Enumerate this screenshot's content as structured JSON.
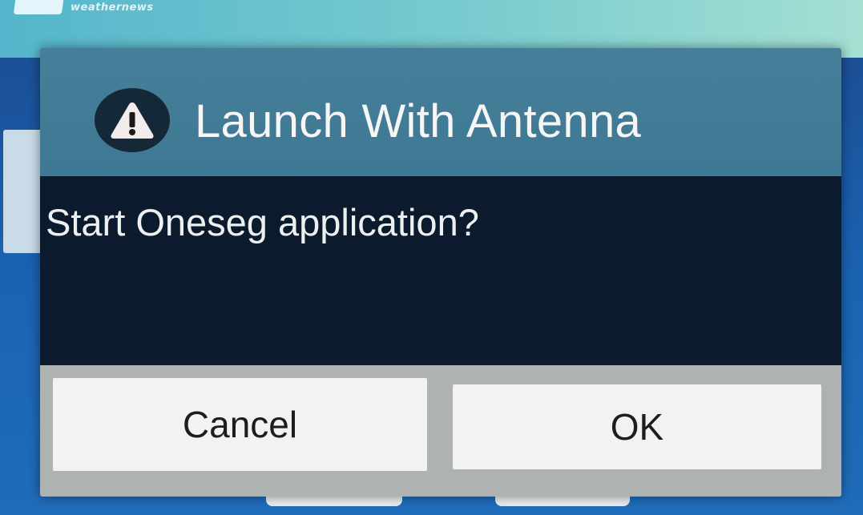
{
  "background_app": {
    "brand": "weathernews",
    "accent_color": "#1b5fa8"
  },
  "dialog": {
    "icon": "warning-icon",
    "title": "Launch With Antenna",
    "message": "Start Oneseg application?",
    "buttons": {
      "cancel_label": "Cancel",
      "ok_label": "OK"
    },
    "colors": {
      "title_bar": "#467f99",
      "body": "#0b1a2c",
      "button_area": "#aeb3b1"
    }
  }
}
